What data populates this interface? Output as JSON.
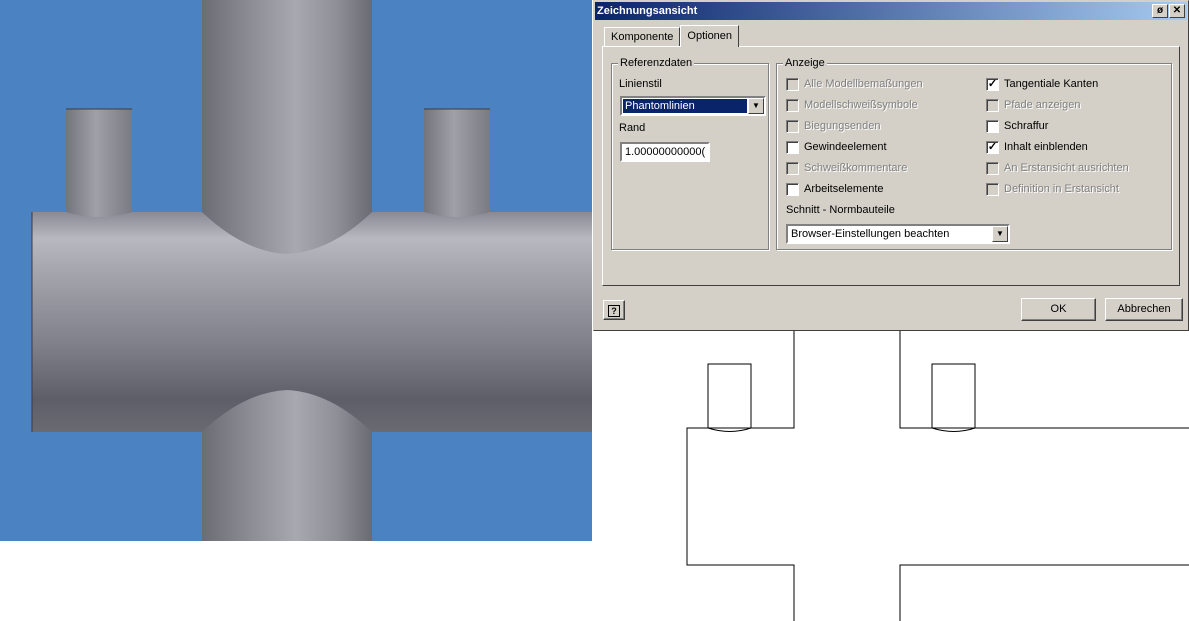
{
  "dialog": {
    "title": "Zeichnungsansicht",
    "tabs": [
      {
        "label": "Komponente",
        "active": false
      },
      {
        "label": "Optionen",
        "active": true
      }
    ],
    "referenzdaten": {
      "legend": "Referenzdaten",
      "linienstil_label": "Linienstil",
      "linienstil_value": "Phantomlinien",
      "rand_label": "Rand",
      "rand_value": "1.00000000000("
    },
    "anzeige": {
      "legend": "Anzeige",
      "checkboxes": [
        {
          "label": "Alle Modellbemaßungen",
          "checked": false,
          "enabled": false
        },
        {
          "label": "Modellschweißsymbole",
          "checked": false,
          "enabled": false
        },
        {
          "label": "Biegungsenden",
          "checked": false,
          "enabled": false
        },
        {
          "label": "Gewindeelement",
          "checked": false,
          "enabled": true
        },
        {
          "label": "Schweißkommentare",
          "checked": false,
          "enabled": false
        },
        {
          "label": "Arbeitselemente",
          "checked": false,
          "enabled": true
        },
        {
          "label": "Tangentiale Kanten",
          "checked": true,
          "enabled": true
        },
        {
          "label": "Pfade anzeigen",
          "checked": false,
          "enabled": false
        },
        {
          "label": "Schraffur",
          "checked": false,
          "enabled": true
        },
        {
          "label": "Inhalt einblenden",
          "checked": true,
          "enabled": true
        },
        {
          "label": "An Erstansicht ausrichten",
          "checked": false,
          "enabled": false
        },
        {
          "label": "Definition in Erstansicht",
          "checked": false,
          "enabled": false
        }
      ],
      "schnitt_label": "Schnitt -  Normbauteile",
      "schnitt_value": "Browser-Einstellungen beachten"
    },
    "buttons": {
      "help_label": "?",
      "ok_label": "OK",
      "cancel_label": "Abbrechen"
    },
    "titlebar_buttons": {
      "pin_label": "ø",
      "close_label": "✕"
    }
  },
  "colors": {
    "viewport_background": "#4a82c2",
    "dialog_face": "#d4d0c8",
    "titlebar_start": "#0a246a",
    "titlebar_end": "#a6caf0"
  },
  "icons": {
    "help": "help-icon",
    "dropdown": "chevron-down-icon",
    "checkmark": "checkmark-icon"
  }
}
